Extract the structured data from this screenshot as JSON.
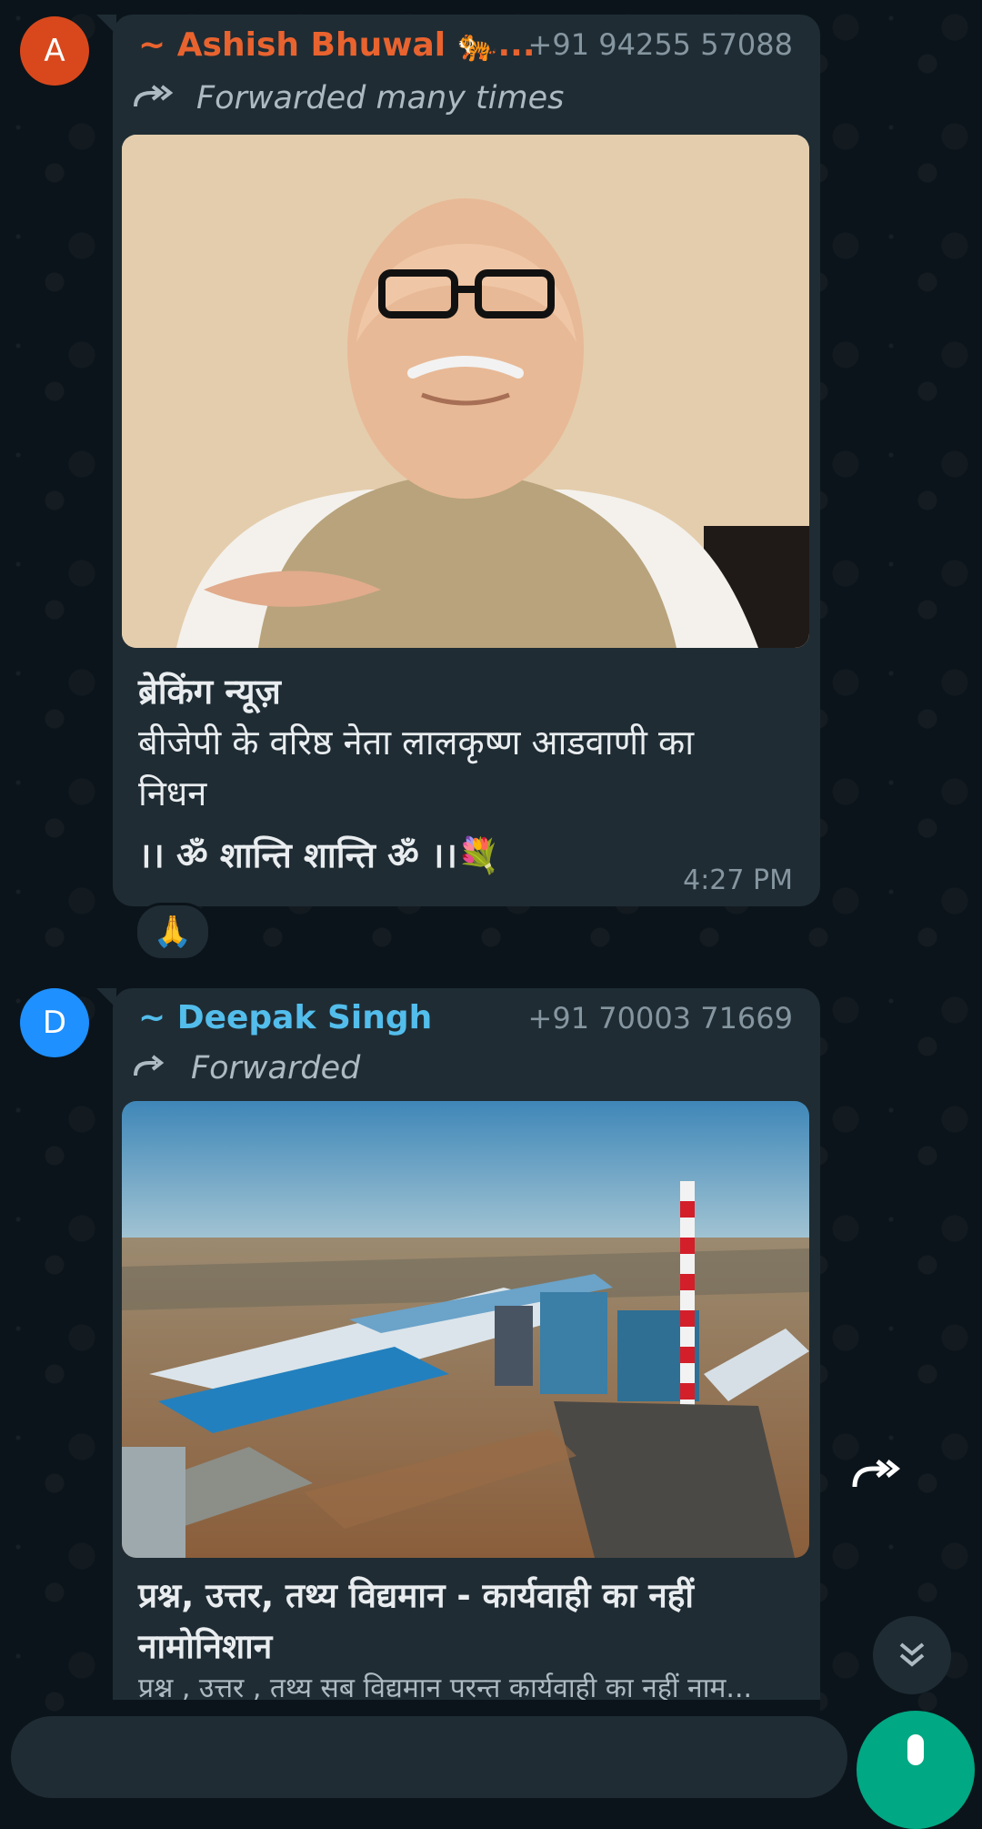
{
  "colors": {
    "chat_background": "#0b141a",
    "bubble": "#1f2c34",
    "sender_1": "#e9632f",
    "sender_2": "#53bdeb",
    "avatar_1": "#d9481c",
    "avatar_2": "#1e90ff",
    "accent_green": "#00a884"
  },
  "messages": [
    {
      "avatar_letter": "A",
      "sender": "~ Ashish Bhuwal 🐅...",
      "phone": "+91 94255 57088",
      "forward_label": "Forwarded many times",
      "image_subject": "portrait-photo",
      "caption_title": "ब्रेकिंग न्यूज़",
      "caption_line_1": " बीजेपी के वरिष्ठ नेता लालकृष्ण आडवाणी का",
      "caption_line_2": "निधन",
      "caption_line_3": "।। ॐ शान्ति शान्ति ॐ ।।💐",
      "time": "4:27 PM",
      "reaction": "🙏"
    },
    {
      "avatar_letter": "D",
      "sender": "~ Deepak Singh",
      "phone": "+91 70003 71669",
      "forward_label": "Forwarded",
      "image_subject": "industrial-plant-aerial-photo",
      "caption_title_line_1": "प्रश्न, उत्तर, तथ्य विद्यमान - कार्यवाही का नहीं",
      "caption_title_line_2": "नामोनिशान",
      "caption_preview": "प्रश्न , उत्तर , तथ्य सब विद्यमान परन्त कार्यवाही का नहीं नाम..."
    }
  ],
  "icons": {
    "forwarded": "double-forward-arrow-icon",
    "forward_action": "forward-icon",
    "scroll_down": "double-chevron-down-icon",
    "microphone": "microphone-icon"
  }
}
